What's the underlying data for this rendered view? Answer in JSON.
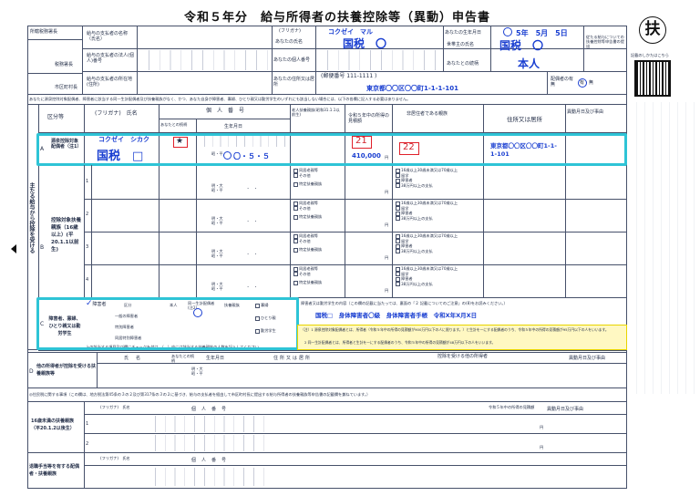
{
  "form": {
    "title": "令和５年分　給与所得者の扶養控除等（異動）申告書",
    "badge": "扶",
    "side_note": "記載のしかたはこちら"
  },
  "header": {
    "office_label": "所轄税務署長",
    "tax_office_label": "税務署長",
    "city_label": "市区町村長",
    "payer_name_label": "給与の支払者の名称（氏名）",
    "payer_number_label": "給与の支払者の法人(個人)番号",
    "payer_address_label": "給与の支払者の所在地(住所)",
    "furigana_label": "(フリガナ)",
    "furigana_value": "コクゼイ　マル",
    "name_label": "あなたの氏名",
    "name_value": "国税　〇",
    "my_number_label": "あなたの個人番号",
    "address_label": "あなたの住所又は居所",
    "postal": "(郵便番号 111-1111 )",
    "address_value": "東京都〇〇区〇〇町1-1-1-101",
    "birth_label": "あなたの生年月日",
    "birth_value": "5年　5月　5日",
    "householder_label": "世帯主の氏名",
    "householder_value": "国税　〇",
    "relation_label": "あなたとの続柄",
    "relation_value": "本人",
    "spouse_label": "配偶者の有無",
    "spouse_value": "有・無",
    "right_note": "従たる給与についての扶養控除等申告書の提出",
    "instruction": "あなたに源泉控除対象配偶者、障害者に該当する同一生計配偶者及び扶養親族がなく、かつ、あなた自身が障害者、寡婦、ひとり親又は勤労学生のいずれにも該当しない場合には、以下の各欄に記入する必要はありません。"
  },
  "main_table": {
    "col_kubun": "区分等",
    "col_furigana": "(フリガナ)　氏名",
    "col_relation": "あなたとの続柄",
    "col_mynumber": "個人番号",
    "col_birth": "生年月日",
    "col_nonresident": "老人扶養親族(昭和31.1.1以前生)",
    "col_income": "令和５年中の所得の見積額",
    "col_nonres": "非居住者である親族",
    "col_address": "住所又は居所",
    "col_change": "異動月日及び事由",
    "row_a_label": "源泉控除対象配偶者（注1）",
    "row_a_mark": "A",
    "spouse_furigana": "コクゼイ　シカク",
    "spouse_name": "国税　□",
    "spouse_relation": "★",
    "spouse_birth": "〇・５・５",
    "spouse_income": "410,000",
    "num_21": "21",
    "num_22": "22",
    "spouse_address": "東京都〇〇区〇〇町1-1-1-101",
    "row_b_label": "控除対象扶養親族（16歳以上）(平20.1.1以前生)",
    "row_b_mark": "B",
    "section_label": "主たる給与から控除を受ける",
    "era_meiji": "明・大",
    "era_showa": "昭・平",
    "dot": "・　・",
    "yen": "円",
    "opt_old1": "同居老親等",
    "opt_other": "その他",
    "opt_special": "特定扶養親族",
    "opt_16": "16歳以上30歳未満又は70歳以上",
    "opt_student": "留学",
    "opt_disabled": "障害者",
    "opt_38": "38万円以上の支払",
    "rows_b": [
      "1",
      "2",
      "3",
      "4"
    ]
  },
  "disabled_section": {
    "label": "障害者、寡婦、ひとり親又は勤労学生",
    "mark": "C",
    "chk_disabled": "障害者",
    "kubun": "区分",
    "honnin": "本人",
    "same_spouse": "同一生計配偶者(注2)",
    "dependent": "扶養親族",
    "general": "一般の障害者",
    "special": "特別障害者",
    "living": "同居特別障害者",
    "widow": "寡婦",
    "single": "ひとり親",
    "student": "勤労学生",
    "detail_header": "障害者又は勤労学生の内容（この欄の記載に当たっては、裏面の「２ 記載についてのご注意」の(8)をお読みください。）",
    "detail_value": "国税□　身体障害者〇級　身体障害者手帳　令和X年X月X日",
    "footnote1": "（注）1 源泉控除対象配偶者とは、所得者（令和５年中の所得の見積額が900万円以下の人に限ります。）と生計を一にする配偶者のうち、令和５年中の所得の見積額が95万円以下の人をいいます。",
    "footnote2": "2 同一生計配偶者とは、所得者と生計を一にする配偶者のうち、令和５年中の所得の見積額が48万円以下の人をいいます。",
    "bottom_note": "上の該当する項目及び欄にチェックを付け、（　）内には該当する扶養親族の人数を記入してください。"
  },
  "other_section": {
    "mark": "D",
    "label": "他の所得者が控除を受ける扶養親族等",
    "name": "氏名",
    "relation": "あなたとの続柄",
    "birth": "生年月日",
    "address": "住所又は居所",
    "taker_header": "控除を受ける他の所得者",
    "taker_name": "氏名",
    "taker_relation": "あなたとの続柄",
    "taker_address": "住所又は居所",
    "change": "異動月日及び事由"
  },
  "resident_tax": {
    "header": "◎住民税に関する事項（この欄は、地方税法第45条の３の２及び第317条の３の２に基づき、給与の支払者を経由して市区町村長に提出する給与所得者の扶養親族等申告書の記載欄を兼ねています。）",
    "under16_label": "16歳未満の扶養親族（平20.1.2以後生）",
    "single_label": "退職手当等を有する配偶者・扶養親族",
    "mynumber": "個人番号",
    "furigana": "(フリガナ)　氏名",
    "rows": [
      "1",
      "2"
    ],
    "income": "令和５年中の所得の見積額",
    "change": "異動月日及び事由"
  }
}
